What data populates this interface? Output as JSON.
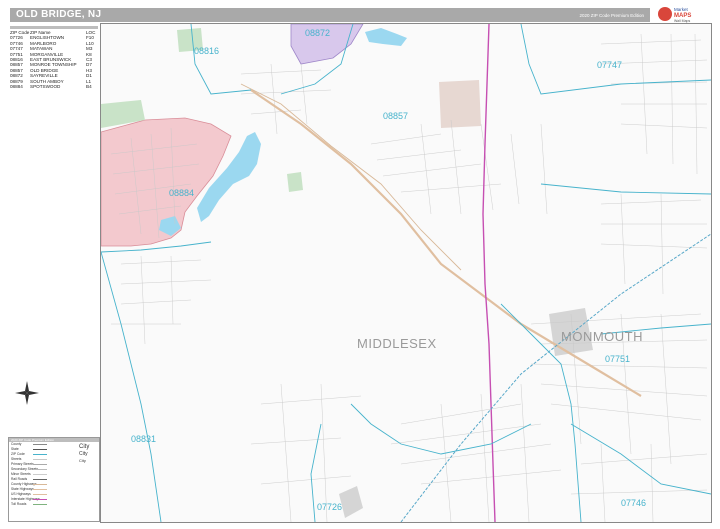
{
  "title": "OLD BRIDGE, NJ",
  "edition": "2020 ZIP Code Premium Edition",
  "logo": {
    "line1": "Market",
    "line2": "MAPS",
    "line3": "Wall Maps"
  },
  "zip_table": {
    "headers": [
      "ZIP Code",
      "ZIP Name",
      "LOC"
    ],
    "rows": [
      [
        "07726",
        "ENGLISHTOWN",
        "F10"
      ],
      [
        "07746",
        "MARLBORO",
        "L10"
      ],
      [
        "07747",
        "MATAWAN",
        "M3"
      ],
      [
        "07751",
        "MORGANVILLE",
        "K8"
      ],
      [
        "08816",
        "EAST BRUNSWICK",
        "C3"
      ],
      [
        "08857",
        "MONROE TOWNSHIP",
        "D7"
      ],
      [
        "08857",
        "OLD BRIDGE",
        "H3"
      ],
      [
        "08872",
        "SAYREVILLE",
        "D1"
      ],
      [
        "08879",
        "SOUTH AMBOY",
        "L1"
      ],
      [
        "08884",
        "SPOTSWOOD",
        "B4"
      ]
    ]
  },
  "zip_labels": [
    "08816",
    "08872",
    "07747",
    "08857",
    "08884",
    "08831",
    "07751",
    "07726",
    "07746"
  ],
  "county_labels": [
    "MIDDLESEX",
    "MONMOUTH"
  ],
  "legend": {
    "title": "2020 ZIP Code Premium Edition",
    "rows": [
      "County",
      "State",
      "ZIP Code",
      "Streets",
      "Primary Streets",
      "Secondary Streets",
      "Minor Streets",
      "Rail Roads",
      "County Highways",
      "State Highways",
      "US Highways",
      "Interstate Highways",
      "Toll Roads"
    ],
    "city_words": [
      "City",
      "City",
      "City"
    ]
  },
  "colors": {
    "zip_boundary": "#47b3cc",
    "spotswood_fill": "#f3c9ce",
    "sayreville_fill": "#d8c8ec",
    "water": "#9bd8f0",
    "park": "#c9e3c8",
    "institution": "#e7d8d2",
    "gray_area": "#d5d5d5",
    "interstate": "#c64fb2",
    "us_highway": "#e0bfa0",
    "street": "#c8c8c8"
  }
}
